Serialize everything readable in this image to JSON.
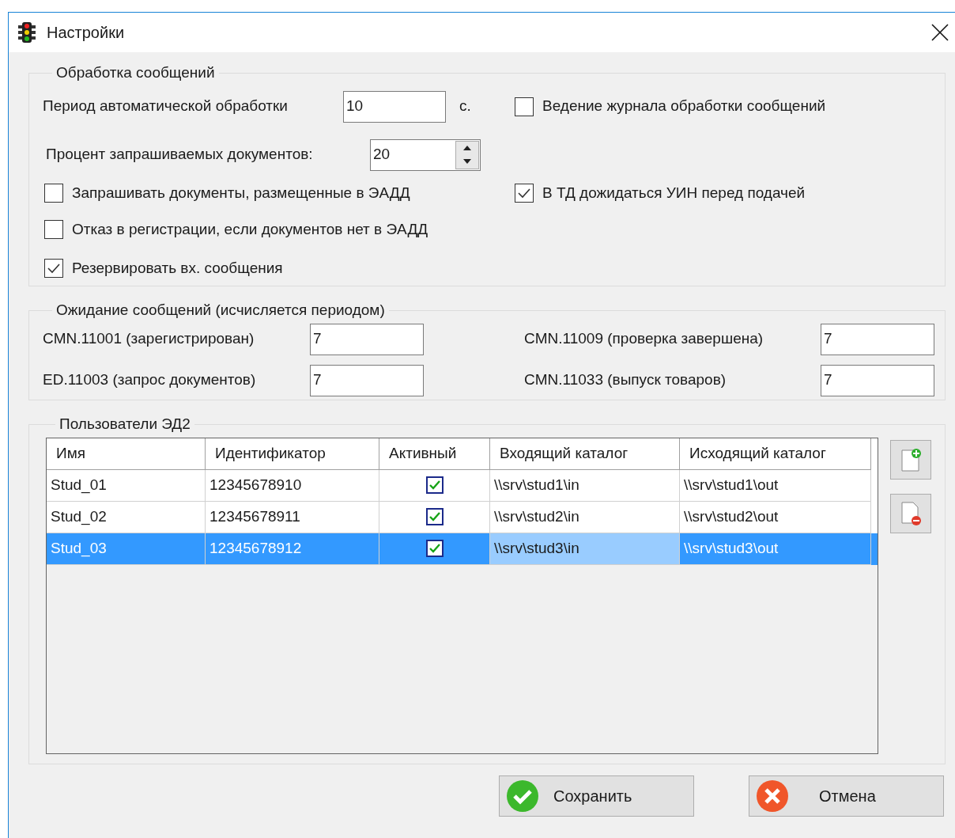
{
  "window": {
    "title": "Настройки"
  },
  "processing": {
    "legend": "Обработка сообщений",
    "period": {
      "label": "Период автоматической обработки",
      "value": "10",
      "unit": "с."
    },
    "percent": {
      "label": "Процент запрашиваемых документов:",
      "value": "20"
    },
    "left_checkboxes": [
      {
        "label": "Запрашивать документы, размещенные в ЭАДД",
        "checked": false
      },
      {
        "label": "Отказ в регистрации, если документов нет в ЭАДД",
        "checked": false
      },
      {
        "label": "Резервировать вх. сообщения",
        "checked": true
      }
    ],
    "right_checkboxes": [
      {
        "label": "Ведение журнала обработки сообщений",
        "checked": false
      },
      {
        "label": "В ТД дожидаться УИН перед подачей",
        "checked": true
      }
    ]
  },
  "waiting": {
    "legend": "Ожидание сообщений (исчисляется периодом)",
    "fields": [
      {
        "label": "CMN.11001 (зарегистрирован)",
        "value": "7"
      },
      {
        "label": "CMN.11009 (проверка завершена)",
        "value": "7"
      },
      {
        "label": "ED.11003 (запрос документов)",
        "value": "7"
      },
      {
        "label": "CMN.11033 (выпуск товаров)",
        "value": "7"
      }
    ]
  },
  "users": {
    "legend": "Пользователи ЭД2",
    "columns": [
      "Имя",
      "Идентификатор",
      "Активный",
      "Входящий каталог",
      "Исходящий каталог"
    ],
    "rows": [
      {
        "selected": false,
        "cells": [
          {
            "kind": "text",
            "text": "Stud_01",
            "focused": false
          },
          {
            "kind": "text",
            "text": "12345678910",
            "focused": false
          },
          {
            "kind": "check",
            "checked": true
          },
          {
            "kind": "text",
            "text": "\\\\srv\\stud1\\in",
            "focused": false
          },
          {
            "kind": "text",
            "text": "\\\\srv\\stud1\\out",
            "focused": false
          }
        ]
      },
      {
        "selected": false,
        "cells": [
          {
            "kind": "text",
            "text": "Stud_02",
            "focused": false
          },
          {
            "kind": "text",
            "text": "12345678911",
            "focused": false
          },
          {
            "kind": "check",
            "checked": true
          },
          {
            "kind": "text",
            "text": "\\\\srv\\stud2\\in",
            "focused": false
          },
          {
            "kind": "text",
            "text": "\\\\srv\\stud2\\out",
            "focused": false
          }
        ]
      },
      {
        "selected": true,
        "cells": [
          {
            "kind": "text",
            "text": "Stud_03",
            "focused": false
          },
          {
            "kind": "text",
            "text": "12345678912",
            "focused": false
          },
          {
            "kind": "check",
            "checked": true
          },
          {
            "kind": "text",
            "text": "\\\\srv\\stud3\\in",
            "focused": true
          },
          {
            "kind": "text",
            "text": "\\\\srv\\stud3\\out",
            "focused": false
          }
        ]
      }
    ]
  },
  "buttons": [
    {
      "kind": "save",
      "label": "Сохранить"
    },
    {
      "kind": "cancel",
      "label": "Отмена"
    }
  ]
}
